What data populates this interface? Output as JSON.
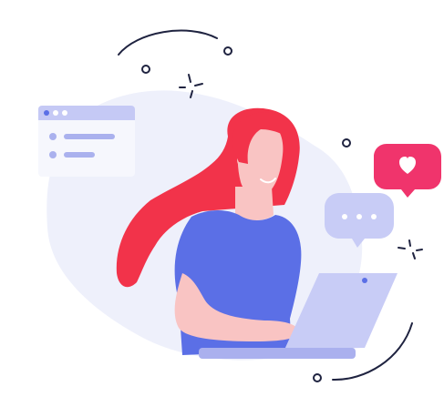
{
  "colors": {
    "background": "#ffffff",
    "blob": "#eef0fb",
    "hair": "#f2334a",
    "skin": "#f9c4c3",
    "shirt": "#5b6fe6",
    "laptop": "#c8ccf6",
    "laptop_dark": "#aab0ee",
    "window_bar": "#c5c9f5",
    "window_body": "#f6f7fd",
    "line_accent": "#aab1ee",
    "chat_bubble": "#c8ccf6",
    "heart_bubble": "#f0346c",
    "doodle": "#1f2340"
  },
  "icons": {
    "browser_window": "browser-window-icon",
    "chat_bubble": "chat-bubble-icon",
    "heart_bubble": "heart-bubble-icon",
    "sparkle": "sparkle-icon"
  }
}
